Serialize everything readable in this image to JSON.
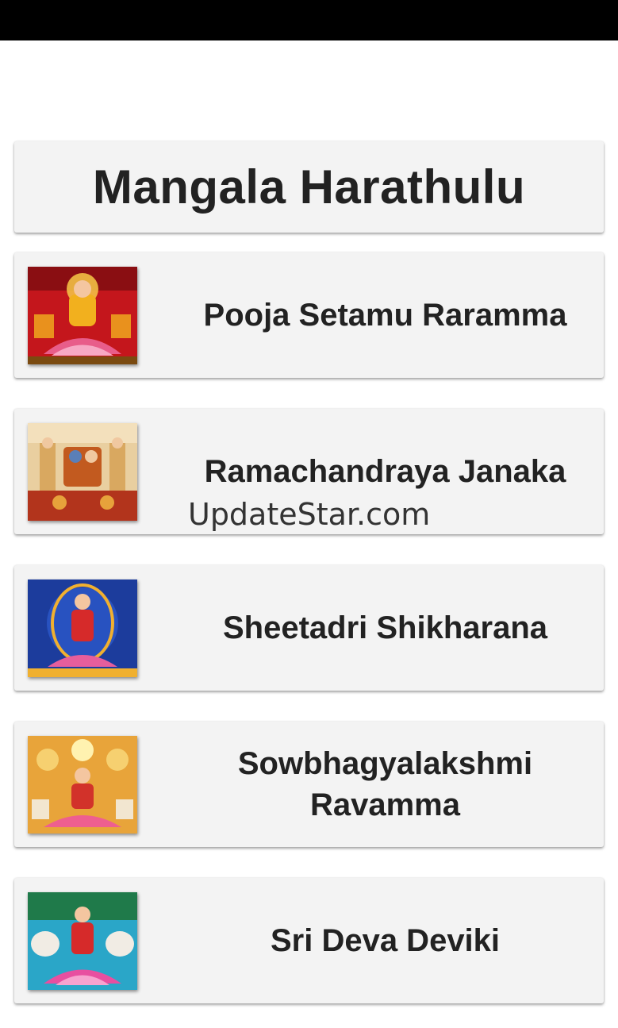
{
  "header": {
    "title": "Mangala Harathulu"
  },
  "items": [
    {
      "label": "Pooja Setamu Raramma",
      "image_icon": "goddess-lakshmi-image",
      "colors": {
        "bg": "#c4161c",
        "accent": "#f2b01e"
      }
    },
    {
      "label": "Ramachandraya Janaka",
      "image_icon": "rama-darbar-image",
      "colors": {
        "bg": "#e9cfa0",
        "accent": "#c25a1f"
      }
    },
    {
      "label": "Sheetadri Shikharana",
      "image_icon": "goddess-durga-image",
      "colors": {
        "bg": "#1c3c9c",
        "accent": "#f0b030"
      }
    },
    {
      "label": "Sowbhagyalakshmi Ravamma",
      "image_icon": "goddess-lakshmi-ganesha-image",
      "colors": {
        "bg": "#e8a43a",
        "accent": "#d2322a"
      }
    },
    {
      "label": "Sri Deva Deviki",
      "image_icon": "lakshmi-elephants-image",
      "colors": {
        "bg": "#2aa6c8",
        "accent": "#e84fa0"
      }
    }
  ],
  "watermark": {
    "text": "UpdateStar.com"
  }
}
